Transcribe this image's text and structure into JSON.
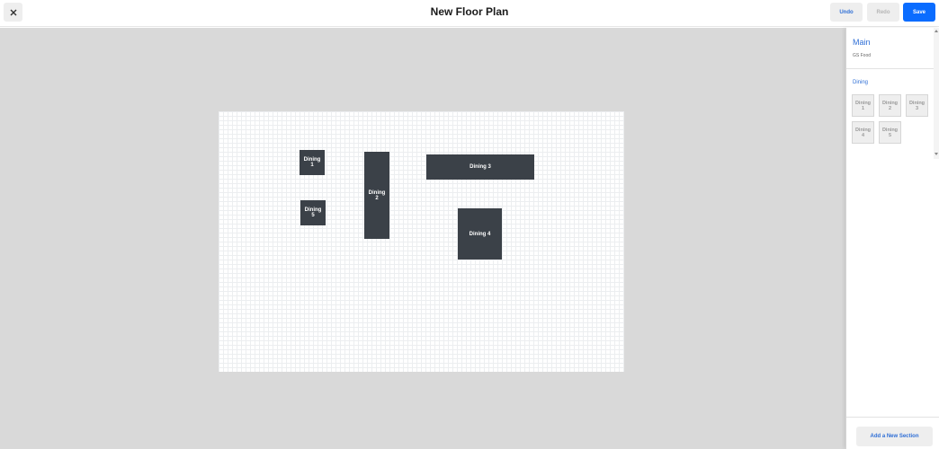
{
  "header": {
    "title": "New Floor Plan",
    "close_icon": "close-icon",
    "undo_label": "Undo",
    "redo_label": "Redo",
    "save_label": "Save"
  },
  "colors": {
    "accent": "#2f6fd6",
    "primary_button": "#0a6cff",
    "table_fill": "#3b4148",
    "canvas_background": "#d9d9d9"
  },
  "floor": {
    "tables": [
      {
        "line1": "Dining",
        "line2": "1"
      },
      {
        "line1": "Dining",
        "line2": "2"
      },
      {
        "line1": "Dining 3",
        "line2": ""
      },
      {
        "line1": "Dining 4",
        "line2": ""
      },
      {
        "line1": "Dining",
        "line2": "5"
      }
    ]
  },
  "sidebar": {
    "main_title": "Main",
    "main_subtitle": "GS Food",
    "section_title": "Dining",
    "chips": [
      {
        "line1": "Dining",
        "line2": "1"
      },
      {
        "line1": "Dining",
        "line2": "2"
      },
      {
        "line1": "Dining",
        "line2": "3"
      },
      {
        "line1": "Dining",
        "line2": "4"
      },
      {
        "line1": "Dining",
        "line2": "5"
      }
    ],
    "add_section_label": "Add a New Section"
  }
}
